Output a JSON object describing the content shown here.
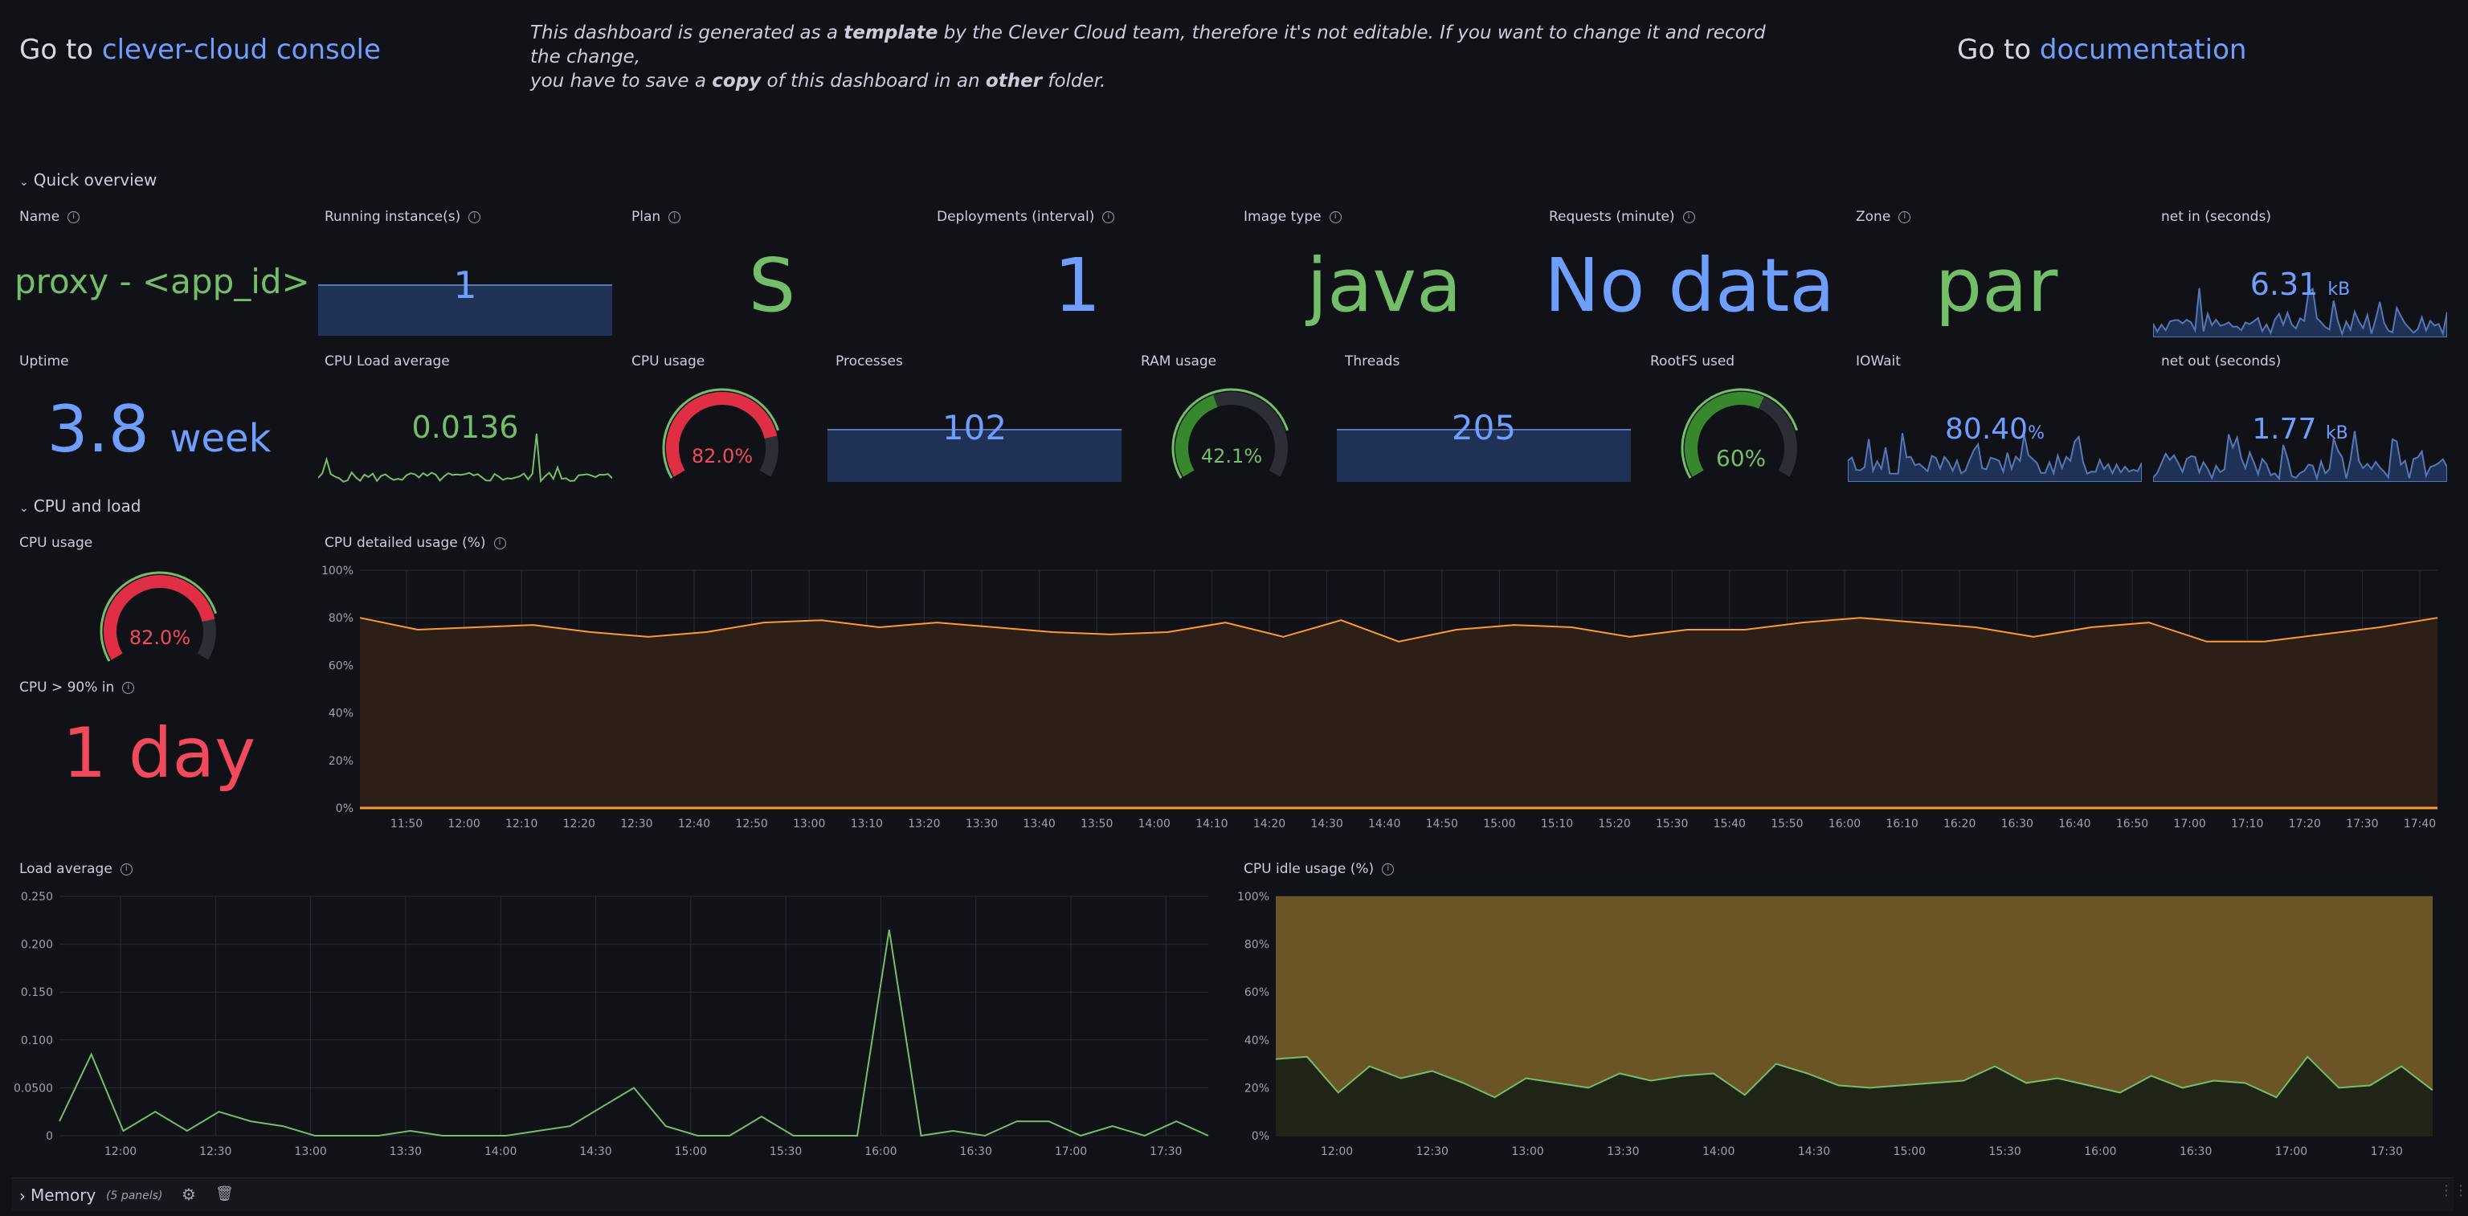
{
  "header": {
    "console_prefix": "Go to ",
    "console_link": "clever-cloud console",
    "doc_prefix": "Go to ",
    "doc_link": "documentation",
    "notice_line1_a": "This dashboard is generated as a ",
    "notice_line1_b": "template",
    "notice_line1_c": " by the Clever Cloud team, therefore it's not editable. If you want to change it and record the change,",
    "notice_line2_a": "you have to save a ",
    "notice_line2_b": "copy",
    "notice_line2_c": " of this dashboard in an ",
    "notice_line2_d": "other",
    "notice_line2_e": " folder."
  },
  "rows": {
    "quick_overview": "Quick overview",
    "cpu_and_load": "CPU and load",
    "memory": "Memory",
    "memory_count": "(5 panels)"
  },
  "stats": {
    "name": {
      "title": "Name",
      "value": "proxy - <app_id>"
    },
    "running": {
      "title": "Running instance(s)",
      "value": "1"
    },
    "plan": {
      "title": "Plan",
      "value": "S"
    },
    "deployments": {
      "title": "Deployments (interval)",
      "value": "1"
    },
    "image_type": {
      "title": "Image type",
      "value": "java"
    },
    "requests": {
      "title": "Requests (minute)",
      "value": "No data"
    },
    "zone": {
      "title": "Zone",
      "value": "par"
    },
    "net_in": {
      "title": "net in (seconds)",
      "value": "6.31",
      "unit": "kB"
    },
    "uptime": {
      "title": "Uptime",
      "value": "3.8",
      "unit": "week"
    },
    "cpu_load_avg": {
      "title": "CPU Load average",
      "value": "0.0136"
    },
    "cpu_usage_gauge": {
      "title": "CPU usage",
      "value": "82.0%",
      "fraction": 0.82
    },
    "processes": {
      "title": "Processes",
      "value": "102"
    },
    "ram_usage": {
      "title": "RAM usage",
      "value": "42.1%",
      "fraction": 0.421
    },
    "threads": {
      "title": "Threads",
      "value": "205"
    },
    "rootfs": {
      "title": "RootFS used",
      "value": "60%",
      "fraction": 0.6
    },
    "iowait": {
      "title": "IOWait",
      "value": "80.40",
      "unit": "%"
    },
    "net_out": {
      "title": "net out (seconds)",
      "value": "1.77",
      "unit": "kB"
    },
    "cpu_usage2": {
      "title": "CPU usage",
      "value": "82.0%",
      "fraction": 0.82
    },
    "cpu90": {
      "title": "CPU > 90% in",
      "value": "1 day"
    }
  },
  "colors": {
    "green": "#73bf69",
    "blue": "#6e9fff",
    "red": "#f2495c",
    "orange": "#ff9830",
    "yellow_fill": "#6b5526",
    "background": "#111217"
  },
  "chart_data": [
    {
      "type": "area",
      "title": "CPU detailed usage (%)",
      "ylim": [
        0,
        100
      ],
      "y_ticks": [
        "0%",
        "20%",
        "40%",
        "60%",
        "80%",
        "100%"
      ],
      "x_ticks": [
        "11:50",
        "12:00",
        "12:10",
        "12:20",
        "12:30",
        "12:40",
        "12:50",
        "13:00",
        "13:10",
        "13:20",
        "13:30",
        "13:40",
        "13:50",
        "14:00",
        "14:10",
        "14:20",
        "14:30",
        "14:40",
        "14:50",
        "15:00",
        "15:10",
        "15:20",
        "15:30",
        "15:40",
        "15:50",
        "16:00",
        "16:10",
        "16:20",
        "16:30",
        "16:40",
        "16:50",
        "17:00",
        "17:10",
        "17:20",
        "17:30",
        "17:40"
      ],
      "series": [
        {
          "values": [
            80,
            75,
            76,
            77,
            74,
            72,
            74,
            78,
            79,
            76,
            78,
            76,
            74,
            73,
            74,
            78,
            72,
            79,
            70,
            75,
            77,
            76,
            72,
            75,
            75,
            78,
            80,
            78,
            76,
            72,
            76,
            78,
            70,
            70,
            73,
            76,
            80
          ]
        }
      ]
    },
    {
      "type": "line",
      "title": "Load average",
      "ylim": [
        0,
        0.25
      ],
      "y_ticks": [
        "0",
        "0.0500",
        "0.100",
        "0.150",
        "0.200",
        "0.250"
      ],
      "x_ticks": [
        "12:00",
        "12:30",
        "13:00",
        "13:30",
        "14:00",
        "14:30",
        "15:00",
        "15:30",
        "16:00",
        "16:30",
        "17:00",
        "17:30"
      ],
      "series": [
        {
          "values": [
            0.015,
            0.085,
            0.005,
            0.025,
            0.005,
            0.025,
            0.015,
            0.01,
            0,
            0,
            0,
            0.005,
            0,
            0,
            0,
            0.005,
            0.01,
            0.03,
            0.05,
            0.01,
            0,
            0,
            0.02,
            0,
            0,
            0,
            0.215,
            0,
            0.005,
            0,
            0.015,
            0.015,
            0,
            0.01,
            0,
            0.015,
            0
          ]
        }
      ]
    },
    {
      "type": "area",
      "title": "CPU idle usage (%)",
      "ylim": [
        0,
        100
      ],
      "y_ticks": [
        "0%",
        "20%",
        "40%",
        "60%",
        "80%",
        "100%"
      ],
      "x_ticks": [
        "12:00",
        "12:30",
        "13:00",
        "13:30",
        "14:00",
        "14:30",
        "15:00",
        "15:30",
        "16:00",
        "16:30",
        "17:00",
        "17:30"
      ],
      "series": [
        {
          "values": [
            32,
            33,
            18,
            29,
            24,
            27,
            22,
            16,
            24,
            22,
            20,
            26,
            23,
            25,
            26,
            17,
            30,
            26,
            21,
            20,
            21,
            22,
            23,
            29,
            22,
            24,
            21,
            18,
            25,
            20,
            23,
            22,
            16,
            33,
            20,
            21,
            29,
            19
          ]
        }
      ]
    }
  ]
}
